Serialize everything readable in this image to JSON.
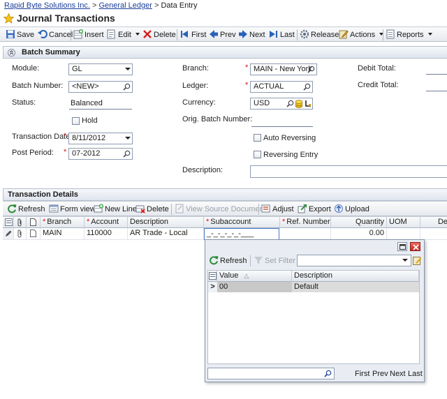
{
  "breadcrumb": {
    "company": "Rapid Byte Solutions Inc.",
    "sep1": ">",
    "module": "General Ledger",
    "sep2": ">",
    "current": "Data Entry"
  },
  "page": {
    "title": "Journal Transactions"
  },
  "toolbar": {
    "save": "Save",
    "cancel": "Cancel",
    "insert": "Insert",
    "edit": "Edit",
    "delete": "Delete",
    "first": "First",
    "prev": "Prev",
    "next": "Next",
    "last": "Last",
    "release": "Release",
    "actions": "Actions",
    "reports": "Reports"
  },
  "batch": {
    "section_title": "Batch Summary",
    "module_label": "Module:",
    "module_value": "GL",
    "batch_number_label": "Batch Number:",
    "batch_number_value": "<NEW>",
    "status_label": "Status:",
    "status_value": "Balanced",
    "hold_label": "Hold",
    "transaction_date_label": "Transaction Date:",
    "transaction_date_value": "8/11/2012",
    "post_period_label": "Post Period:",
    "post_period_value": "07-2012",
    "branch_label": "Branch:",
    "branch_value": "MAIN - New York",
    "ledger_label": "Ledger:",
    "ledger_value": "ACTUAL",
    "currency_label": "Currency:",
    "currency_value": "USD",
    "orig_batch_label": "Orig. Batch Number:",
    "auto_reversing_label": "Auto Reversing",
    "reversing_entry_label": "Reversing Entry",
    "description_label": "Description:",
    "debit_total_label": "Debit Total:",
    "credit_total_label": "Credit Total:",
    "required_mark": "*"
  },
  "details": {
    "section_title": "Transaction Details",
    "toolbar": {
      "refresh": "Refresh",
      "form_view": "Form view",
      "new_line": "New Line",
      "delete": "Delete",
      "view_source": "View Source Document",
      "adjust": "Adjust",
      "export": "Export",
      "upload": "Upload"
    },
    "columns": {
      "branch": "Branch",
      "account": "Account",
      "description": "Description",
      "subaccount": "Subaccount",
      "ref_number": "Ref. Number",
      "quantity": "Quantity",
      "uom": "UOM",
      "more": "De"
    },
    "row": {
      "branch": "MAIN",
      "account": "110000",
      "description": "AR Trade - Local",
      "subaccount": "_-_-_-_-_-___",
      "ref_number": "",
      "quantity": "0.00",
      "uom": ""
    }
  },
  "lookup": {
    "refresh": "Refresh",
    "set_filter": "Set Filter",
    "filter_value": "",
    "col_value": "Value",
    "col_description": "Description",
    "row_value": "00",
    "row_description": "Default",
    "row_indicator": ">",
    "search_value": "",
    "pager": {
      "first": "First",
      "prev": "Prev",
      "next": "Next",
      "last": "Last"
    }
  },
  "colors": {
    "link": "#1b3e9a",
    "required": "#dd1111",
    "header_bg": "#dfe5ee",
    "selected_row": "#dcdcdc"
  }
}
